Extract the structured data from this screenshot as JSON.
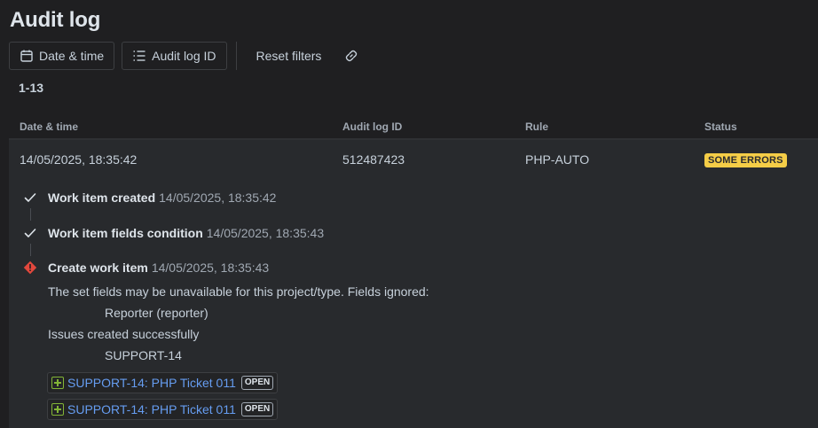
{
  "page": {
    "title": "Audit log"
  },
  "toolbar": {
    "date_label": "Date & time",
    "id_label": "Audit log ID",
    "reset_label": "Reset filters"
  },
  "results": {
    "range": "1-13"
  },
  "table": {
    "columns": [
      "Date & time",
      "Audit log ID",
      "Rule",
      "Status"
    ],
    "rows": [
      {
        "date": "14/05/2025, 18:35:42",
        "id": "512487423",
        "rule": "PHP-AUTO",
        "status": "SOME ERRORS"
      }
    ]
  },
  "details": {
    "steps": [
      {
        "title": "Work item created",
        "time": "14/05/2025, 18:35:42",
        "state": "success"
      },
      {
        "title": "Work item fields condition",
        "time": "14/05/2025, 18:35:43",
        "state": "success"
      },
      {
        "title": "Create work item",
        "time": "14/05/2025, 18:35:43",
        "state": "error"
      }
    ],
    "messages": [
      "The set fields may be unavailable for this project/type. Fields ignored:",
      "Reporter (reporter)",
      "Issues created successfully",
      "SUPPORT-14"
    ],
    "issues": [
      {
        "label": "SUPPORT-14: PHP Ticket 011",
        "status": "OPEN"
      },
      {
        "label": "SUPPORT-14: PHP Ticket 011",
        "status": "OPEN"
      }
    ]
  },
  "colors": {
    "background": "#1f1f21",
    "row_panel": "#282a2d",
    "badge": "#f5cd47",
    "error": "#e2483d",
    "link": "#669df1",
    "issue_icon": "#82b536"
  },
  "icons": {
    "date": "calendar-icon",
    "id": "list-icon",
    "link": "link-icon",
    "success": "check-icon",
    "error": "error-diamond-icon",
    "issue": "add-issue-icon"
  }
}
